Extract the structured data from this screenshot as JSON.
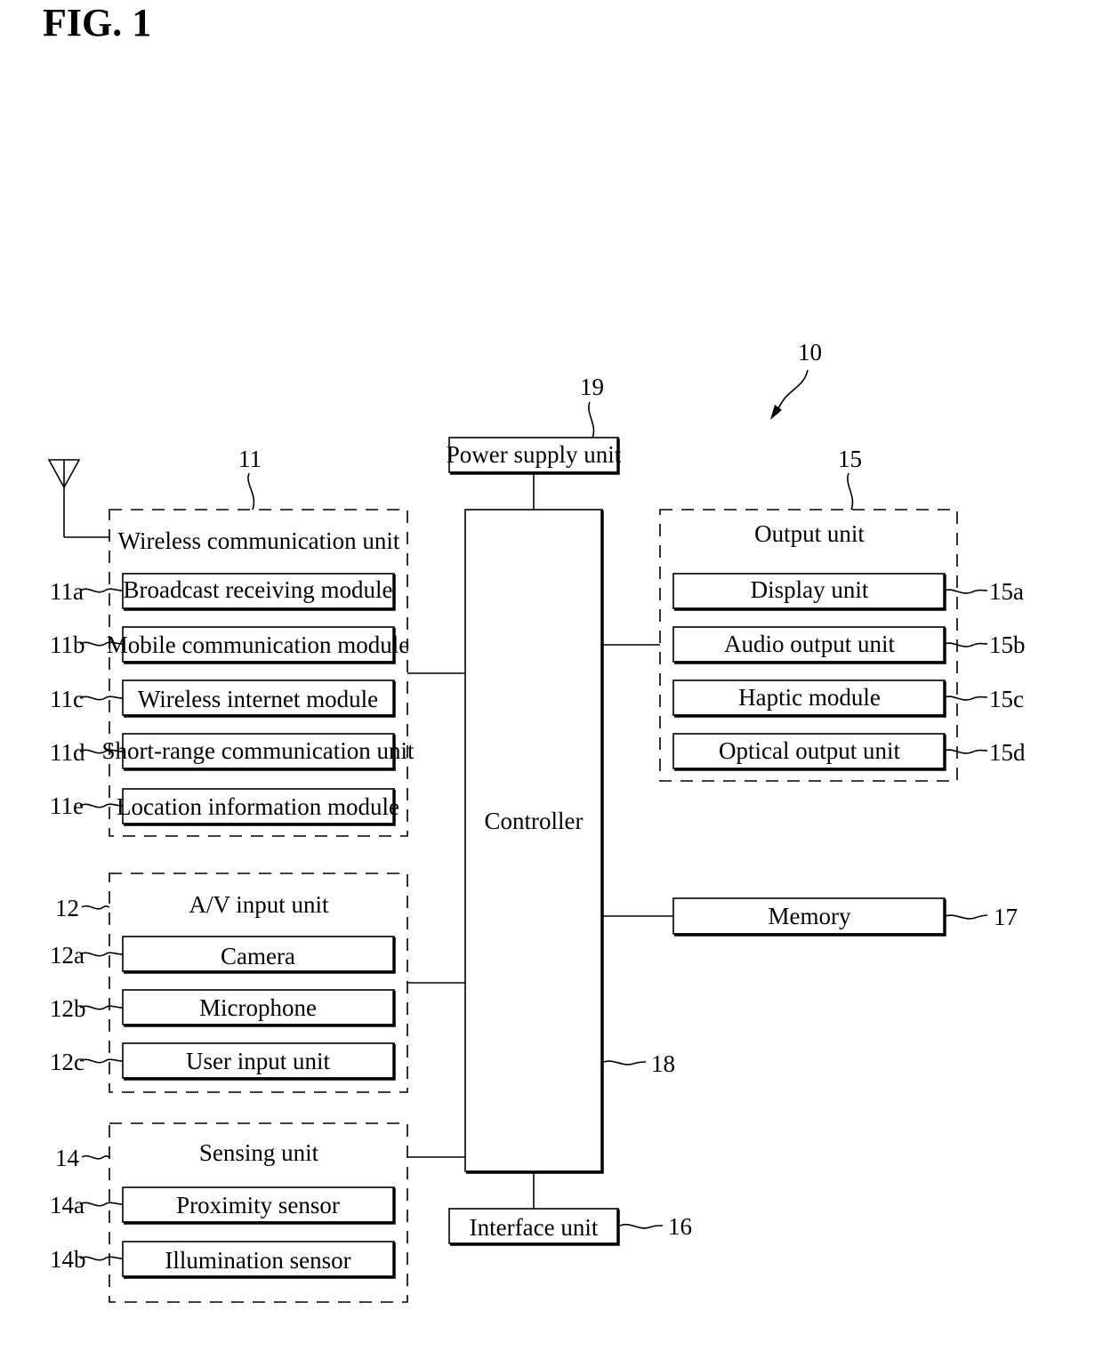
{
  "figure": {
    "title": "FIG. 1",
    "ref": "10"
  },
  "wireless": {
    "ref": "11",
    "title": "Wireless communication unit",
    "items": [
      {
        "ref": "11a",
        "label": "Broadcast receiving module"
      },
      {
        "ref": "11b",
        "label": "Mobile communication module"
      },
      {
        "ref": "11c",
        "label": "Wireless internet module"
      },
      {
        "ref": "11d",
        "label": "Short-range communication unit"
      },
      {
        "ref": "11e",
        "label": "Location information module"
      }
    ]
  },
  "av_input": {
    "ref": "12",
    "title": "A/V input unit",
    "items": [
      {
        "ref": "12a",
        "label": "Camera"
      },
      {
        "ref": "12b",
        "label": "Microphone"
      },
      {
        "ref": "12c",
        "label": "User input unit"
      }
    ]
  },
  "sensing": {
    "ref": "14",
    "title": "Sensing unit",
    "items": [
      {
        "ref": "14a",
        "label": "Proximity sensor"
      },
      {
        "ref": "14b",
        "label": "Illumination sensor"
      }
    ]
  },
  "output": {
    "ref": "15",
    "title": "Output unit",
    "items": [
      {
        "ref": "15a",
        "label": "Display unit"
      },
      {
        "ref": "15b",
        "label": "Audio output unit"
      },
      {
        "ref": "15c",
        "label": "Haptic module"
      },
      {
        "ref": "15d",
        "label": "Optical output unit"
      }
    ]
  },
  "interface": {
    "ref": "16",
    "label": "Interface unit"
  },
  "memory": {
    "ref": "17",
    "label": "Memory"
  },
  "controller": {
    "ref": "18",
    "label": "Controller"
  },
  "power": {
    "ref": "19",
    "label": "Power supply unit"
  }
}
